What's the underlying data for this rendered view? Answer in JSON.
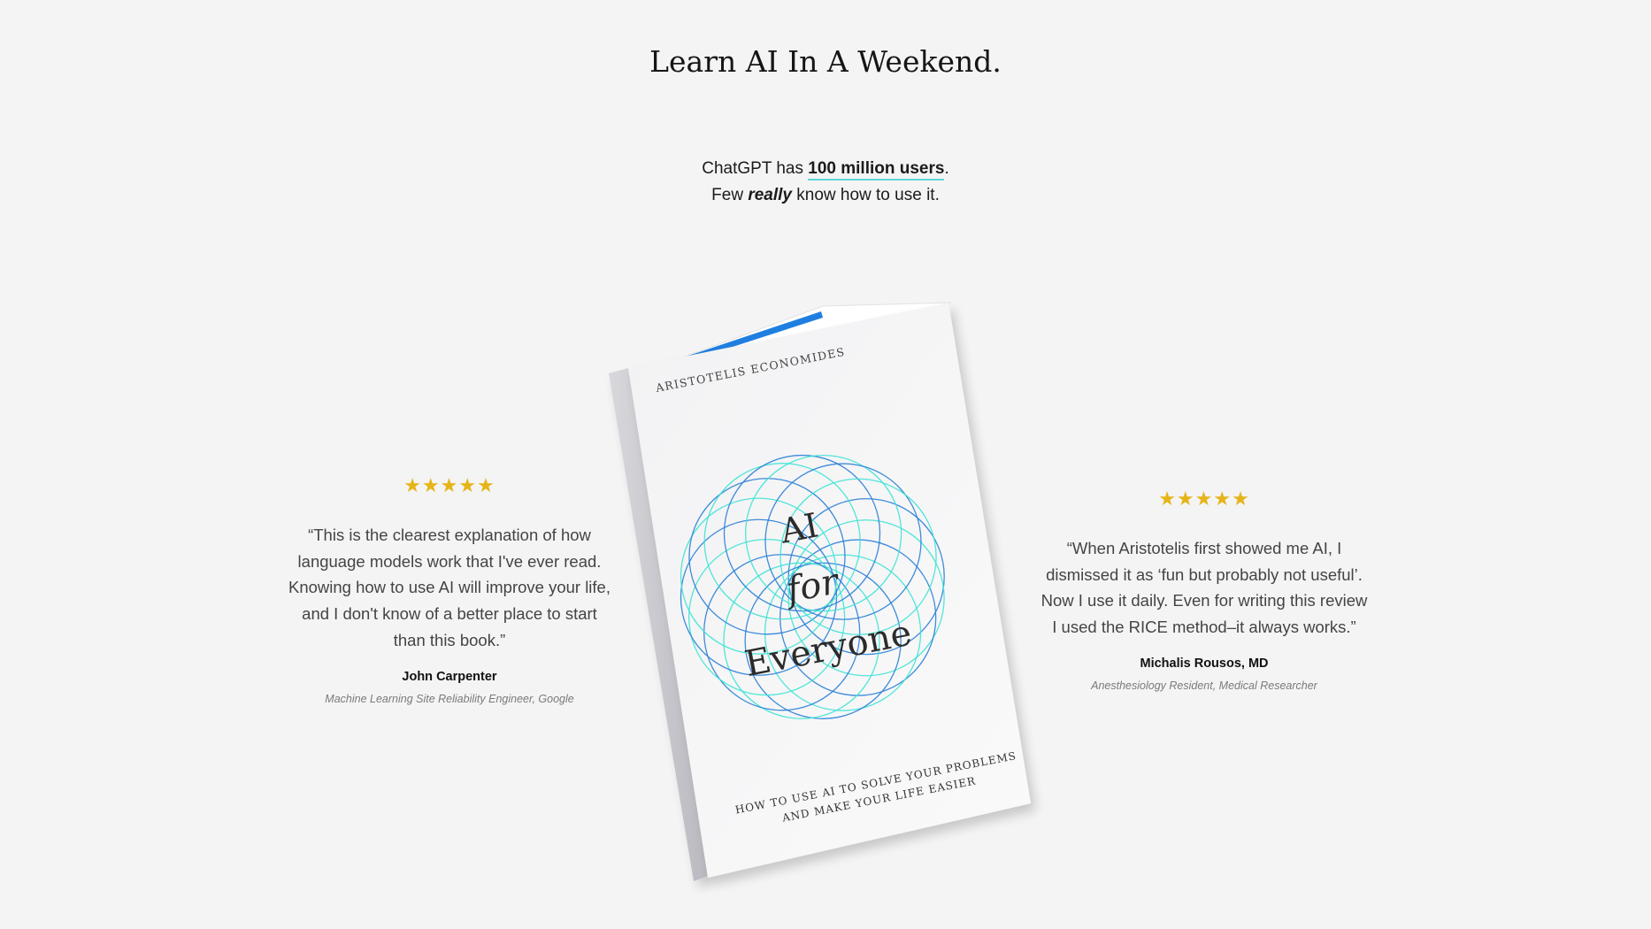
{
  "headline": "Learn AI In A Weekend.",
  "intro": {
    "line1_prefix": "ChatGPT has ",
    "line1_highlight": "100 million users",
    "line1_suffix": ".",
    "line2_prefix": "Few ",
    "line2_emphasis": "really",
    "line2_suffix": " know how to use it."
  },
  "book": {
    "author": "ARISTOTELIS ECONOMIDES",
    "title_line1": "AI",
    "title_line2": "for",
    "title_line3": "Everyone",
    "subtitle_line1": "HOW TO USE AI TO SOLVE YOUR PROBLEMS",
    "subtitle_line2": "AND MAKE YOUR LIFE EASIER",
    "colors": {
      "spine_accent": "#1f7fe0",
      "circle_outer": "#2a7fd6",
      "circle_inner": "#3fe3d4"
    }
  },
  "reviews": [
    {
      "stars": "★★★★★",
      "quote_lines": [
        "“This is the clearest explanation of how",
        "language models work that I've ever read.",
        "Knowing how to use AI will improve your life,",
        "and I don't know of a better place to start",
        "than this book.”"
      ],
      "name": "John Carpenter",
      "role": "Machine Learning Site Reliability Engineer, Google"
    },
    {
      "stars": "★★★★★",
      "quote_lines": [
        "“When Aristotelis first showed me AI, I",
        "dismissed it as ‘fun but probably not useful’.",
        "Now I use it daily. Even for writing this review",
        "I used the RICE method–it always works.”"
      ],
      "name": "Michalis Rousos, MD",
      "role": "Anesthesiology Resident, Medical Researcher"
    }
  ],
  "colors": {
    "background": "#f4f4f4",
    "star": "#e6b418",
    "highlight_underline": "#5fd6dc"
  }
}
